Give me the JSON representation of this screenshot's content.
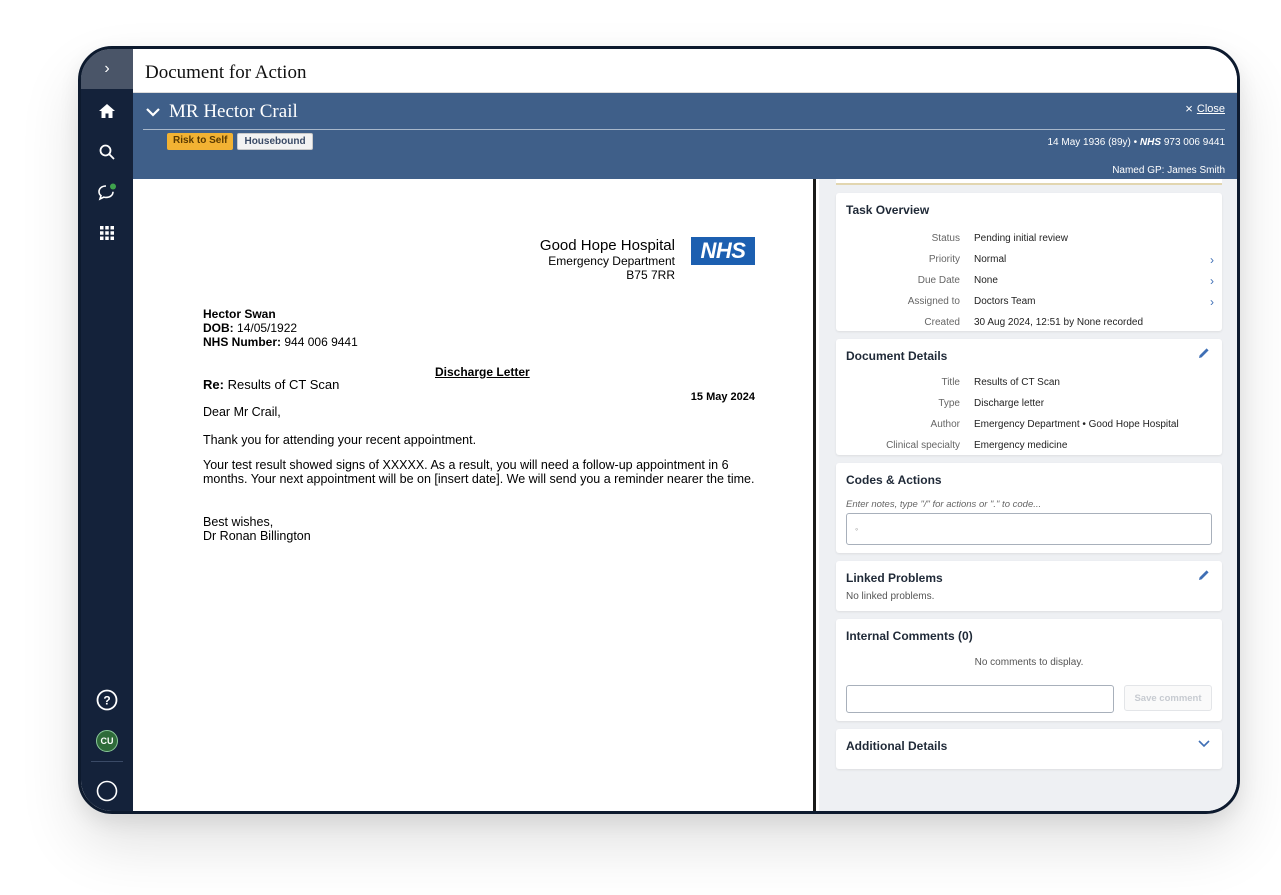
{
  "window": {
    "title": "Document for Action"
  },
  "sidebar": {
    "toggle_glyph": "›",
    "items": [
      {
        "icon": "home-icon"
      },
      {
        "icon": "search-icon"
      },
      {
        "icon": "chat-icon"
      },
      {
        "icon": "apps-grid-icon"
      }
    ],
    "help_glyph": "?",
    "avatar_initials": "CU"
  },
  "patient": {
    "name": "MR Hector Crail",
    "close_label": "Close",
    "close_glyph": "×",
    "dob_age": "14 May 1936 (89y)",
    "nhs_label": "NHS",
    "nhs_number": "973 006 9441",
    "named_gp": "Named GP: James Smith",
    "tags": [
      "Risk to Self",
      "Housebound"
    ]
  },
  "document": {
    "hospital_name": "Good Hope Hospital",
    "department": "Emergency Department",
    "postcode": "B75 7RR",
    "logo_text": "NHS",
    "patient_name": "Hector Swan",
    "dob_label": "DOB:",
    "dob_value": "14/05/1922",
    "nhs_label": "NHS Number:",
    "nhs_value": "944 006 9441",
    "letter_title": "Discharge Letter",
    "re_label": "Re:",
    "re_value": "Results of CT Scan",
    "date": "15 May 2024",
    "salutation": "Dear Mr Crail,",
    "para1": "Thank you for attending your recent appointment.",
    "para2": "Your test result showed signs of XXXXX. As a result, you will need a follow-up appointment in 6 months. Your next appointment will be on [insert date]. We will send you a reminder nearer the time.",
    "signoff": "Best wishes,",
    "signature": "Dr Ronan Billington"
  },
  "task_overview": {
    "heading": "Task Overview",
    "rows": [
      {
        "label": "Status",
        "value": "Pending initial review"
      },
      {
        "label": "Priority",
        "value": "Normal"
      },
      {
        "label": "Due Date",
        "value": "None"
      },
      {
        "label": "Assigned to",
        "value": "Doctors Team"
      },
      {
        "label": "Created",
        "value": "30 Aug 2024, 12:51 by None recorded"
      }
    ],
    "arrow_glyph": "›"
  },
  "document_details": {
    "heading": "Document Details",
    "rows": [
      {
        "label": "Title",
        "value": "Results of CT Scan"
      },
      {
        "label": "Type",
        "value": "Discharge letter"
      },
      {
        "label": "Author",
        "value": "Emergency Department • Good Hope Hospital"
      },
      {
        "label": "Clinical specialty",
        "value": "Emergency medicine"
      }
    ]
  },
  "codes_actions": {
    "heading": "Codes & Actions",
    "placeholder": "Enter notes, type \"/\" for actions or \".\" to code...",
    "input_value": "",
    "cursor_glyph": "◦"
  },
  "linked_problems": {
    "heading": "Linked Problems",
    "empty_text": "No linked problems."
  },
  "internal_comments": {
    "heading": "Internal Comments (0)",
    "empty_text": "No comments to display.",
    "save_label": "Save comment"
  },
  "additional_details": {
    "heading": "Additional Details"
  },
  "colors": {
    "sidebar": "#14223a",
    "banner": "#3f5f89",
    "risk_tag": "#f2b233",
    "nhs_blue": "#1c5fb0",
    "accent_link": "#3f6fb5"
  }
}
